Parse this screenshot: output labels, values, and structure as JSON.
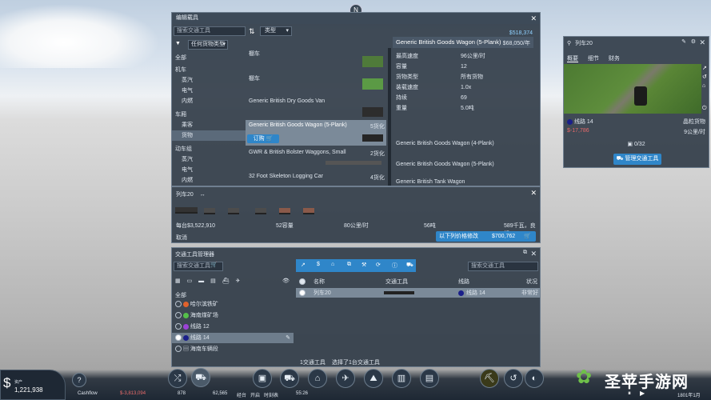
{
  "compass_label": "N",
  "catalog": {
    "title": "编辑载具",
    "search_placeholder": "搜索交通工具",
    "sort_label": "类型",
    "filter_label": "任何货物类型",
    "tree": [
      "全部",
      "机车",
      "蒸汽",
      "电气",
      "内燃",
      "车厢",
      "乘客",
      "货物",
      "动车组",
      "蒸汽",
      "电气",
      "内燃"
    ],
    "vehicles": [
      {
        "name": "棚车",
        "stat": ""
      },
      {
        "name": "棚车",
        "stat": ""
      },
      {
        "name": "Generic British Dry Goods Van",
        "stat": ""
      },
      {
        "name": "Generic British Goods Wagon (5-Plank)",
        "stat": "5货化"
      },
      {
        "name": "GWR & British Bolster Waggons, Small",
        "stat": "2货化"
      },
      {
        "name": "32 Foot Skeleton Logging Car",
        "stat": "4货化"
      }
    ],
    "selected_action": "订购",
    "detail": {
      "price": "$518,374",
      "title": "Generic British Goods Wagon (5-Plank)",
      "title_price": "$68,050/年",
      "stats": [
        {
          "label": "最高速度",
          "value": "96公里/时"
        },
        {
          "label": "容量",
          "value": "12"
        },
        {
          "label": "货物类型",
          "value": "所有货物"
        },
        {
          "label": "装载速度",
          "value": "1.0x"
        },
        {
          "label": "持续",
          "value": "69"
        },
        {
          "label": "重量",
          "value": "5.0吨"
        }
      ],
      "related": [
        "Generic British Goods Wagon (4-Plank)",
        "Generic British Goods Wagon (5-Plank)",
        "Generic British Tank Wagon"
      ]
    }
  },
  "consist": {
    "title": "列车20",
    "cost": "每台$3,522,910",
    "capacity": "52容量",
    "speed": "80公里/时",
    "power": "56吨",
    "weight": "589千瓦，良好",
    "cancel": "取消",
    "order_label": "以下列价格修改",
    "order_price": "$700,762"
  },
  "info": {
    "title": "列车20",
    "tabs": [
      "概要",
      "细节",
      "财务"
    ],
    "line": "线路 14",
    "line_status": "晶粒货物",
    "money": "$-17,786",
    "speed": "9公里/时",
    "load": "0/32",
    "manage": "管理交通工具"
  },
  "manager": {
    "title": "交通工具管理器",
    "search_placeholder": "搜索交通工具",
    "search2_placeholder": "搜索交通工具",
    "all_label": "全部",
    "lines": [
      {
        "name": "哈尔滨铁矿",
        "color": "#e0622c"
      },
      {
        "name": "海南煤矿场",
        "color": "#55c04a"
      },
      {
        "name": "线路 12",
        "color": "#9b42d6"
      },
      {
        "name": "线路 14",
        "color": "#1a1f8a"
      },
      {
        "name": "海南车辆段",
        "color": "#7a8796"
      }
    ],
    "headers": [
      "名称",
      "交通工具",
      "线路",
      "状况"
    ],
    "rows": [
      {
        "name": "列车20",
        "line": "线路 14",
        "status": "非常好"
      }
    ],
    "footer_count": "1交通工具",
    "footer_selected": "选择了1台交通工具"
  },
  "status": {
    "money": "1,221,938",
    "money_label": "资产",
    "cashflow_label": "Cashflow",
    "cashflow": "$-3,813,094",
    "pop": "878",
    "vehicles": "62,565",
    "t1": "经台",
    "t2": "开启",
    "t3": "时刻表",
    "time": "55:26",
    "date": "1801年1月",
    "watermark": "圣苹手游网",
    "help": "?",
    "currency": "$"
  },
  "colors": {
    "accent": "#2f86c9",
    "panel": "#343e4a"
  }
}
